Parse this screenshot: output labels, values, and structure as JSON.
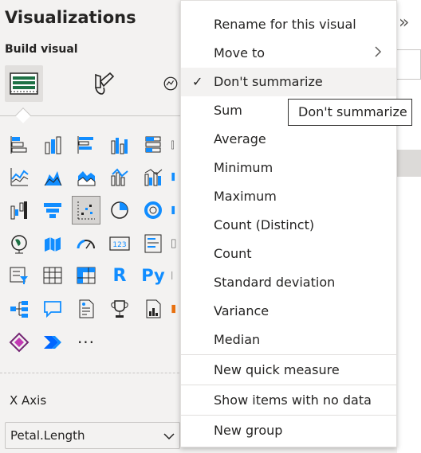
{
  "panel": {
    "title": "Visualizations",
    "build_label": "Build visual"
  },
  "tabs": [
    {
      "name": "build-visual-tab",
      "icon": "table-grid-icon",
      "selected": true
    },
    {
      "name": "format-visual-tab",
      "icon": "paintbrush-icon",
      "selected": false
    },
    {
      "name": "analytics-tab",
      "icon": "magnifier-chart-icon",
      "selected": false
    }
  ],
  "field_well": {
    "axis_label": "X Axis",
    "field_value": "Petal.Length"
  },
  "menu": {
    "items": [
      {
        "label": "Rename for this visual",
        "checked": false,
        "submenu": false
      },
      {
        "label": "Move to",
        "checked": false,
        "submenu": true
      },
      {
        "label": "Don't summarize",
        "checked": true,
        "submenu": false
      },
      {
        "label": "Sum",
        "checked": false,
        "submenu": false
      },
      {
        "label": "Average",
        "checked": false,
        "submenu": false
      },
      {
        "label": "Minimum",
        "checked": false,
        "submenu": false
      },
      {
        "label": "Maximum",
        "checked": false,
        "submenu": false
      },
      {
        "label": "Count (Distinct)",
        "checked": false,
        "submenu": false
      },
      {
        "label": "Count",
        "checked": false,
        "submenu": false
      },
      {
        "label": "Standard deviation",
        "checked": false,
        "submenu": false
      },
      {
        "label": "Variance",
        "checked": false,
        "submenu": false
      },
      {
        "label": "Median",
        "checked": false,
        "submenu": false
      },
      {
        "label": "New quick measure",
        "checked": false,
        "submenu": false
      },
      {
        "label": "Show items with no data",
        "checked": false,
        "submenu": false
      },
      {
        "label": "New group",
        "checked": false,
        "submenu": false
      }
    ],
    "check_glyph": "✓"
  },
  "tooltip": "Don't summarize",
  "right_strip": {
    "collapse_glyph": "»"
  },
  "gallery": {
    "more_glyph": "···",
    "r_label": "R",
    "py_label": "Py",
    "card_label": "123"
  },
  "colors": {
    "accent": "#118dff",
    "dark": "#252423",
    "selected_tab_bg": "#e1dfdd",
    "menu_hover": "#f3f2f1",
    "green": "#1e7145"
  }
}
